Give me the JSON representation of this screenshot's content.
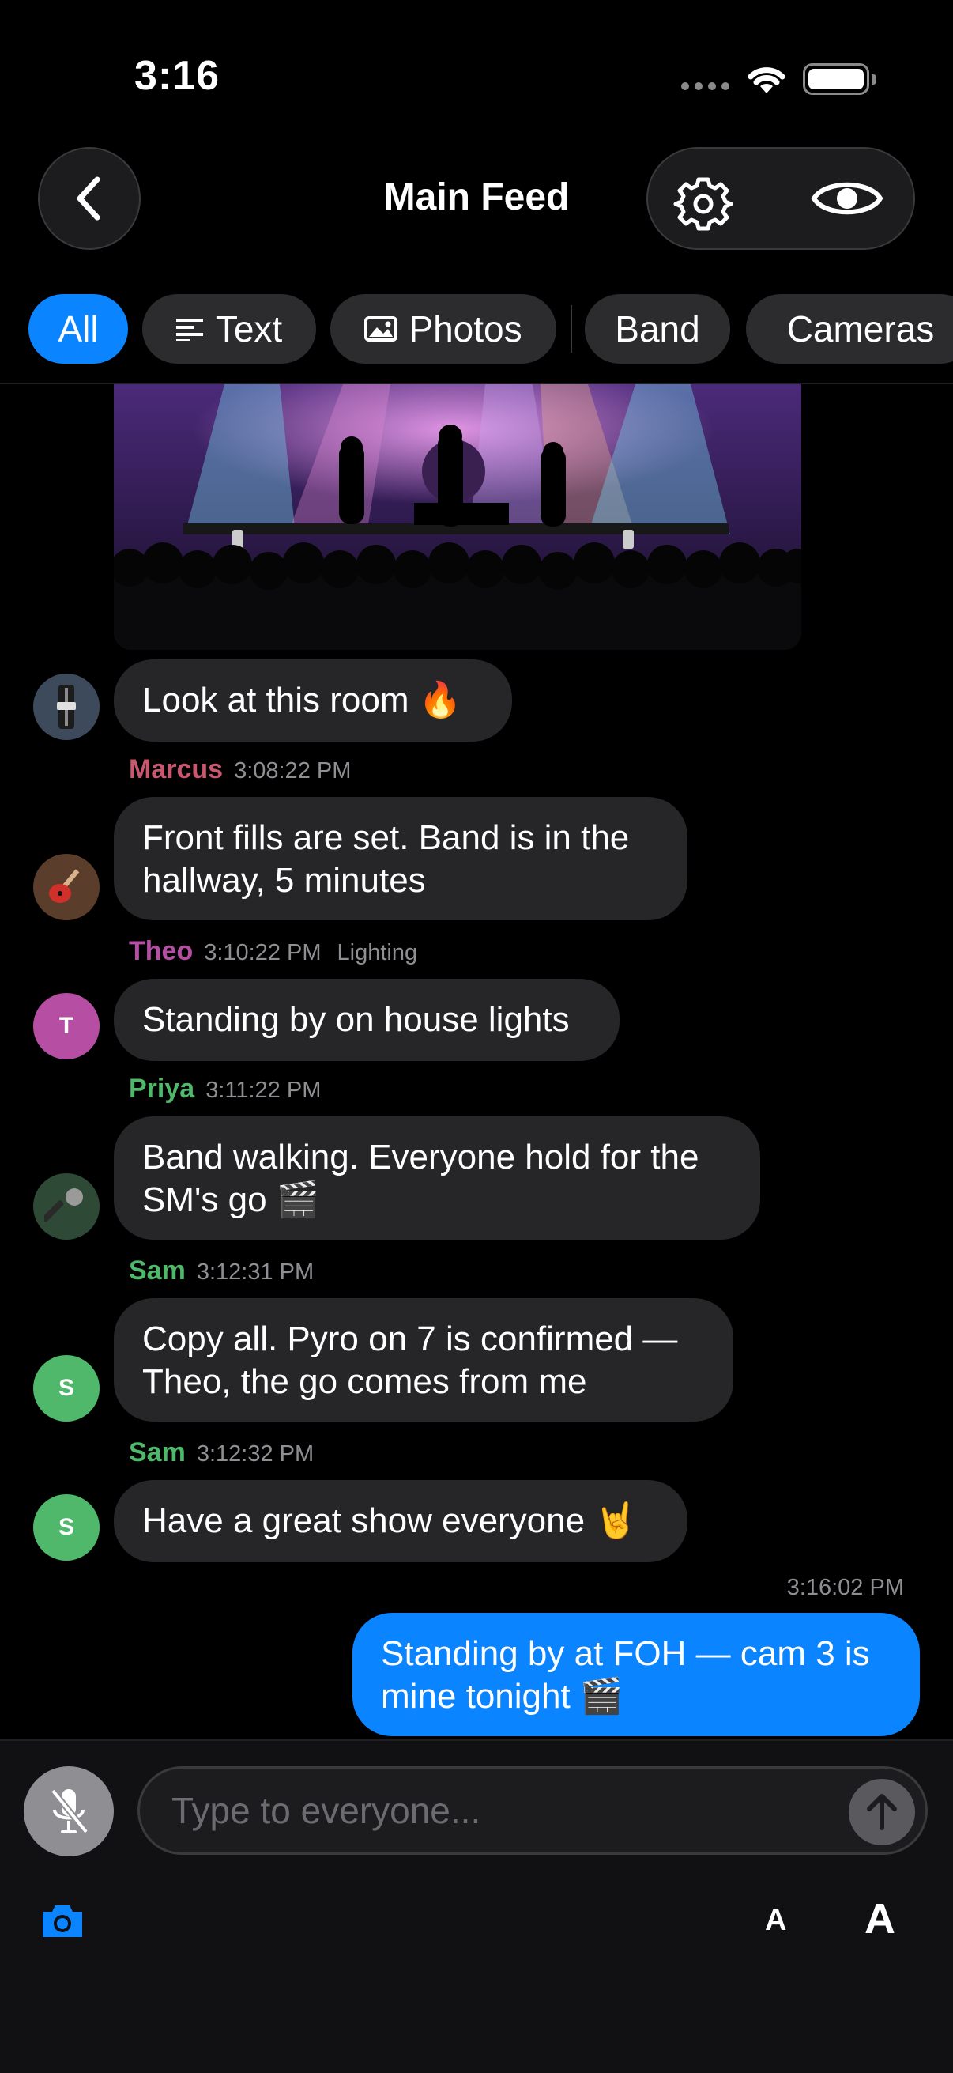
{
  "status_bar": {
    "time": "3:16"
  },
  "header": {
    "title": "Main Feed"
  },
  "filters": [
    {
      "label": "All",
      "icon": "",
      "active": true
    },
    {
      "label": "Text",
      "icon": "text-lines-icon",
      "active": false
    },
    {
      "label": "Photos",
      "icon": "photo-icon",
      "active": false
    },
    {
      "label": "Band",
      "icon": "",
      "active": false
    },
    {
      "label": "Cameras",
      "icon": "",
      "active": false
    }
  ],
  "messages": [
    {
      "text": "Look at this room 🔥",
      "avatar_icon": "fader-icon"
    },
    {
      "sender": "Marcus",
      "time": "3:08:22 PM",
      "text": "Front fills are set. Band is in the hallway, 5 minutes",
      "avatar_icon": "guitar-icon",
      "color": "#c8586f"
    },
    {
      "sender": "Theo",
      "time": "3:10:22 PM",
      "role": "Lighting",
      "text": "Standing by on house lights",
      "avatar_initial": "T",
      "color": "#b64fa4"
    },
    {
      "sender": "Priya",
      "time": "3:11:22 PM",
      "text": "Band walking. Everyone hold for the SM's go 🎬",
      "avatar_icon": "microphone-icon",
      "color": "#4fb86a"
    },
    {
      "sender": "Sam",
      "time": "3:12:31 PM",
      "text": "Copy all. Pyro on 7 is confirmed — Theo, the go comes from me",
      "avatar_initial": "S",
      "color": "#4fb86a"
    },
    {
      "sender": "Sam",
      "time": "3:12:32 PM",
      "text": "Have a great show everyone 🤘",
      "avatar_initial": "S",
      "color": "#4fb86a"
    },
    {
      "time": "3:16:02 PM",
      "text": "Standing by at FOH — cam 3 is mine tonight 🎬",
      "mine": true
    }
  ],
  "composer": {
    "placeholder": "Type to everyone...",
    "font_small": "A",
    "font_large": "A"
  },
  "colors": {
    "accent": "#0a84ff",
    "bubble": "#262628",
    "background": "#000000"
  }
}
